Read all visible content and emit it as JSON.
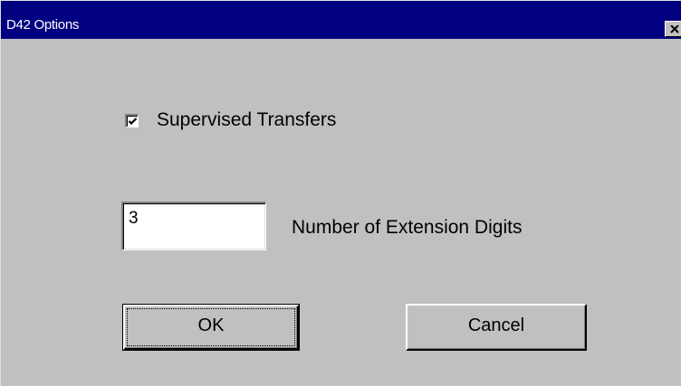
{
  "window": {
    "title": "D42 Options",
    "close_glyph": "×"
  },
  "options": {
    "supervised_transfers": {
      "label": "Supervised Transfers",
      "checked": true
    },
    "extension_digits": {
      "value": "3",
      "label": "Number of Extension Digits"
    }
  },
  "buttons": {
    "ok_label": "OK",
    "cancel_label": "Cancel"
  },
  "colors": {
    "titlebar": "#000080",
    "face": "#c0c0c0"
  }
}
